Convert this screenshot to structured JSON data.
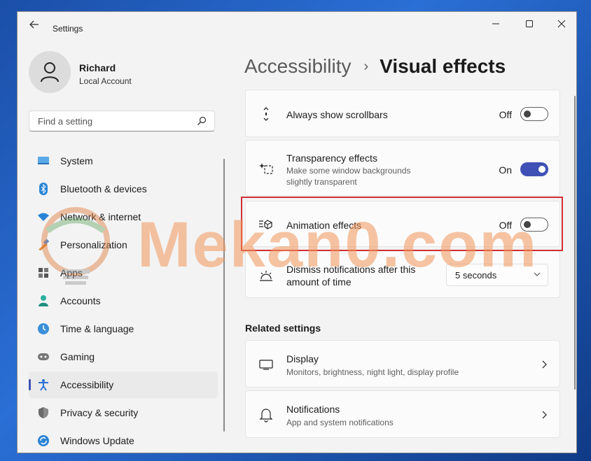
{
  "window": {
    "title": "Settings"
  },
  "profile": {
    "name": "Richard",
    "account_type": "Local Account"
  },
  "search": {
    "placeholder": "Find a setting"
  },
  "sidebar": {
    "items": [
      {
        "label": "System",
        "icon": "system-icon"
      },
      {
        "label": "Bluetooth & devices",
        "icon": "bluetooth-icon"
      },
      {
        "label": "Network & internet",
        "icon": "network-icon"
      },
      {
        "label": "Personalization",
        "icon": "personalization-icon"
      },
      {
        "label": "Apps",
        "icon": "apps-icon"
      },
      {
        "label": "Accounts",
        "icon": "accounts-icon"
      },
      {
        "label": "Time & language",
        "icon": "time-language-icon"
      },
      {
        "label": "Gaming",
        "icon": "gaming-icon"
      },
      {
        "label": "Accessibility",
        "icon": "accessibility-icon",
        "active": true
      },
      {
        "label": "Privacy & security",
        "icon": "shield-icon"
      },
      {
        "label": "Windows Update",
        "icon": "update-icon"
      }
    ]
  },
  "breadcrumb": {
    "parent": "Accessibility",
    "separator": "›",
    "current": "Visual effects"
  },
  "settings": {
    "scrollbars": {
      "title": "Always show scrollbars",
      "state": "Off",
      "on": false,
      "icon": "scrollbars-icon"
    },
    "transparency": {
      "title": "Transparency effects",
      "description_line1": "Make some window backgrounds",
      "description_line2": "slightly transparent",
      "state": "On",
      "on": true,
      "icon": "transparency-icon"
    },
    "animation": {
      "title": "Animation effects",
      "state": "Off",
      "on": false,
      "icon": "animation-icon"
    },
    "notifications_dismiss": {
      "title_line1": "Dismiss notifications after this",
      "title_line2": "amount of time",
      "value": "5 seconds",
      "icon": "brightness-icon"
    }
  },
  "related": {
    "title": "Related settings",
    "display": {
      "title": "Display",
      "description": "Monitors, brightness, night light, display profile",
      "icon": "display-icon"
    },
    "notifications": {
      "title": "Notifications",
      "description": "App and system notifications",
      "icon": "bell-icon"
    }
  },
  "watermark": {
    "text": "Mekan0.com"
  },
  "colors": {
    "accent": "#3f51b5",
    "highlight": "#d22f35",
    "background": "#f3f3f3"
  }
}
